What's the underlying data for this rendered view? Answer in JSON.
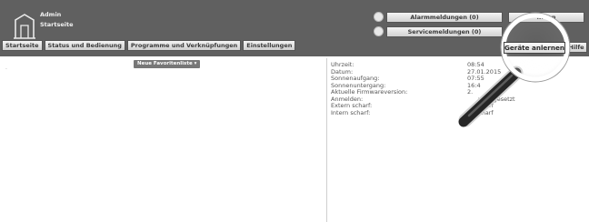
{
  "header": {
    "user": "Admin",
    "location": "Startseite"
  },
  "nav": {
    "items": [
      {
        "label": "Startseite"
      },
      {
        "label": "Status und Bedienung"
      },
      {
        "label": "Programme und Verknüpfungen"
      },
      {
        "label": "Einstellungen"
      }
    ]
  },
  "status": {
    "alarm_label": "Alarmmeldungen (0)",
    "service_label": "Servicemeldungen (0)"
  },
  "right_buttons": {
    "top_label": "...den",
    "teach_label": "Geräte anlernen",
    "help_label": "Hilfe"
  },
  "favorites": {
    "button_label": "Neue Favoritenliste"
  },
  "info": {
    "rows": [
      {
        "label": "Uhrzeit:",
        "value": "08:54"
      },
      {
        "label": "Datum:",
        "value": "27.01.2015"
      },
      {
        "label": "Sonnenaufgang:",
        "value": "07:55"
      },
      {
        "label": "Sonnenuntergang:",
        "value": "16:4"
      },
      {
        "label": "Aktuelle Firmwareversion:",
        "value": "2."
      },
      {
        "label": "Anmelden:",
        "value": "wort gesetzt"
      },
      {
        "label": "Extern scharf:",
        "value": "harf"
      },
      {
        "label": "Intern scharf:",
        "value": "charf"
      }
    ]
  },
  "icons": {
    "logo": "house-logo-icon",
    "status_indicator": "status-dot-icon",
    "magnifier": "magnifier-icon"
  }
}
